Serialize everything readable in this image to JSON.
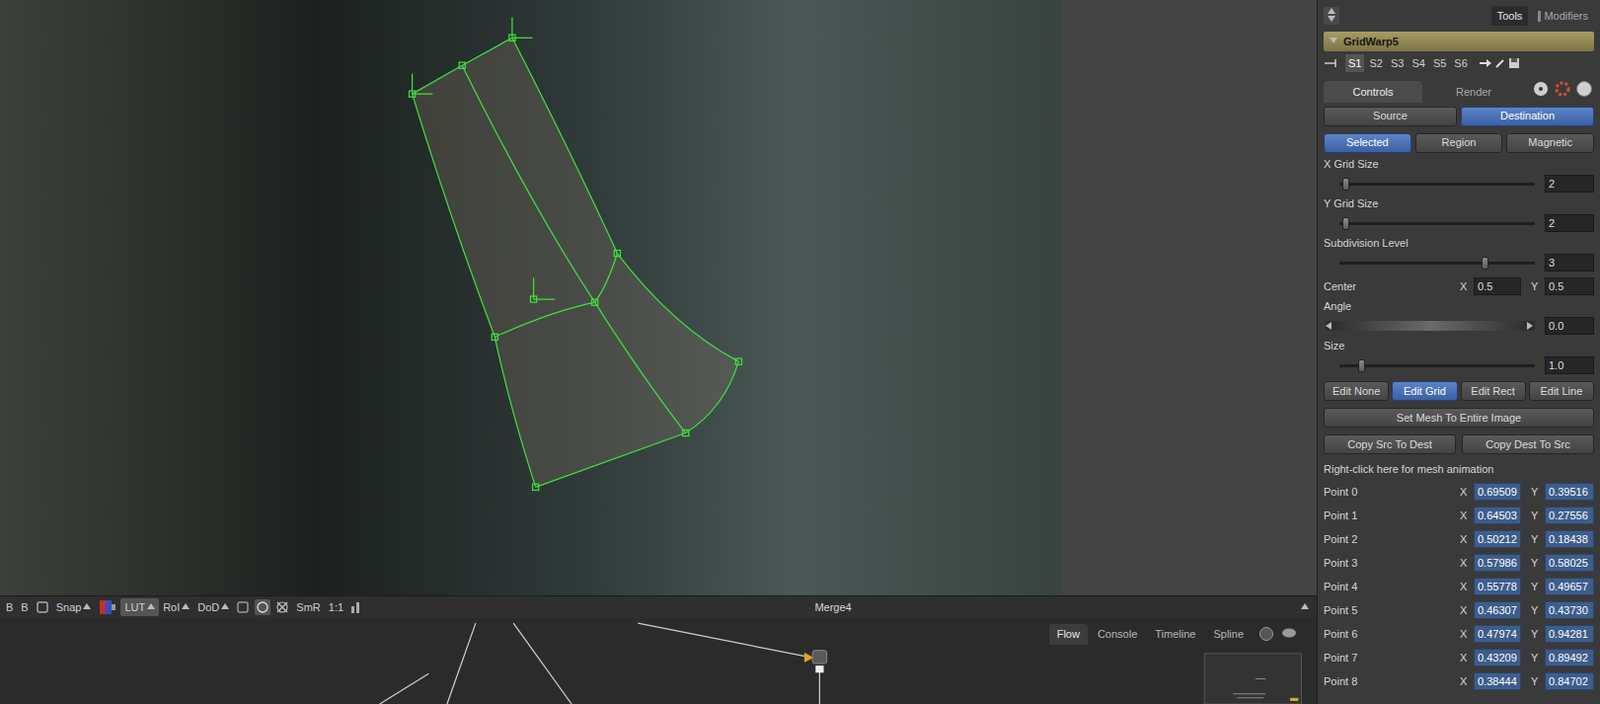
{
  "panel_tabs": [
    {
      "label": "Tools",
      "selected": true
    },
    {
      "label": "Modifiers",
      "selected": false
    }
  ],
  "tool": {
    "name": "GridWarp5",
    "slots": [
      {
        "label": "S1",
        "selected": true
      },
      {
        "label": "S2",
        "selected": false
      },
      {
        "label": "S3",
        "selected": false
      },
      {
        "label": "S4",
        "selected": false
      },
      {
        "label": "S5",
        "selected": false
      },
      {
        "label": "S6",
        "selected": false
      }
    ]
  },
  "control_tabs": [
    {
      "label": "Controls",
      "selected": true
    },
    {
      "label": "Render",
      "selected": false
    }
  ],
  "mode_buttons": [
    {
      "label": "Source",
      "selected": false
    },
    {
      "label": "Destination",
      "selected": true
    }
  ],
  "select_buttons": [
    {
      "label": "Selected",
      "selected": true
    },
    {
      "label": "Region",
      "selected": false
    },
    {
      "label": "Magnetic",
      "selected": false
    }
  ],
  "sliders": [
    {
      "label": "X Grid Size",
      "value": "2",
      "level": 0.03
    },
    {
      "label": "Y Grid Size",
      "value": "2",
      "level": 0.03
    },
    {
      "label": "Subdivision Level",
      "value": "3",
      "level": 0.74
    }
  ],
  "center": {
    "label": "Center",
    "x_label": "X",
    "x": "0.5",
    "y_label": "Y",
    "y": "0.5"
  },
  "angle": {
    "label": "Angle",
    "value": "0.0"
  },
  "size": {
    "label": "Size",
    "value": "1.0",
    "level": 0.11
  },
  "edit_buttons": [
    {
      "label": "Edit None",
      "selected": false
    },
    {
      "label": "Edit Grid",
      "selected": true
    },
    {
      "label": "Edit Rect",
      "selected": false
    },
    {
      "label": "Edit Line",
      "selected": false
    }
  ],
  "set_mesh_button": "Set Mesh To Entire Image",
  "copy_buttons": [
    "Copy Src To Dest",
    "Copy Dest To Src"
  ],
  "mesh_animation_hint": "Right-click here for mesh animation",
  "points": [
    {
      "label": "Point 0",
      "x_label": "X",
      "x": "0.69509",
      "y_label": "Y",
      "y": "0.39516"
    },
    {
      "label": "Point 1",
      "x_label": "X",
      "x": "0.64503",
      "y_label": "Y",
      "y": "0.27556"
    },
    {
      "label": "Point 2",
      "x_label": "X",
      "x": "0.50212",
      "y_label": "Y",
      "y": "0.18438"
    },
    {
      "label": "Point 3",
      "x_label": "X",
      "x": "0.57986",
      "y_label": "Y",
      "y": "0.58025"
    },
    {
      "label": "Point 4",
      "x_label": "X",
      "x": "0.55778",
      "y_label": "Y",
      "y": "0.49657"
    },
    {
      "label": "Point 5",
      "x_label": "X",
      "x": "0.46307",
      "y_label": "Y",
      "y": "0.43730"
    },
    {
      "label": "Point 6",
      "x_label": "X",
      "x": "0.47974",
      "y_label": "Y",
      "y": "0.94281"
    },
    {
      "label": "Point 7",
      "x_label": "X",
      "x": "0.43209",
      "y_label": "Y",
      "y": "0.89492"
    },
    {
      "label": "Point 8",
      "x_label": "X",
      "x": "0.38444",
      "y_label": "Y",
      "y": "0.84702"
    }
  ],
  "viewer_toolbar": {
    "groups": [
      [
        {
          "label": "B",
          "menu": false,
          "selected": false
        },
        {
          "label": "B",
          "menu": false,
          "selected": false
        }
      ],
      [
        {
          "label": "Snap",
          "menu": true,
          "selected": false
        }
      ],
      [
        {
          "label": "LUT",
          "menu": true,
          "selected": true
        },
        {
          "label": "RoI",
          "menu": true,
          "selected": false
        },
        {
          "label": "DoD",
          "menu": true,
          "selected": false
        }
      ],
      [
        {
          "label": "SmR",
          "menu": false,
          "selected": false
        },
        {
          "label": "1:1",
          "menu": false,
          "selected": false
        }
      ]
    ],
    "title": "Merge4"
  },
  "flow_tabs": [
    {
      "label": "Flow",
      "selected": true
    },
    {
      "label": "Console",
      "selected": false
    },
    {
      "label": "Timeline",
      "selected": false
    },
    {
      "label": "Spline",
      "selected": false
    }
  ]
}
